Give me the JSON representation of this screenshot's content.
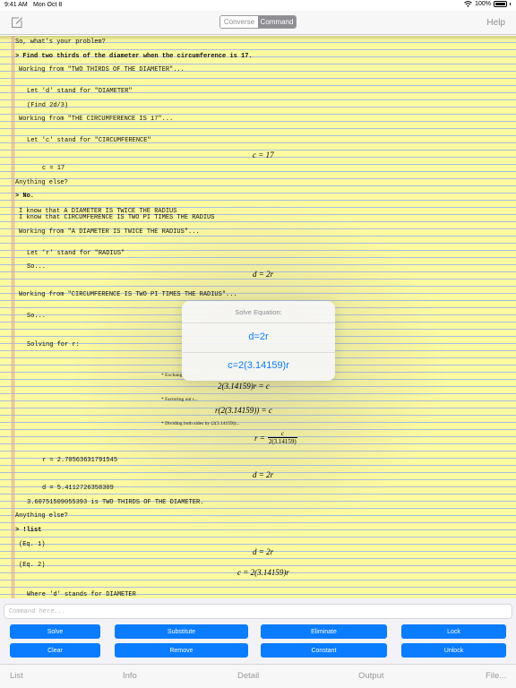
{
  "status_bar": {
    "time": "9:41 AM",
    "date": "Mon Oct 8",
    "battery": "100%"
  },
  "nav": {
    "segments": [
      "Converse",
      "Command"
    ],
    "active_segment": "Command",
    "help_label": "Help",
    "compose_icon": "compose-icon"
  },
  "transcript": {
    "lines": [
      "So, what's your problem?",
      "> Find two thirds of the diameter when the circumference is 17.",
      "Working from \"TWO THIRDS OF THE DIAMETER\"...",
      "Let 'd' stand for \"DIAMETER\"",
      "(Find 2d/3)",
      "Working from \"THE CIRCUMFERENCE IS 17\"...",
      "Let 'c' stand for \"CIRCUMFERENCE\"",
      "c = 17",
      "Anything else?",
      "> No.",
      "I know that A DIAMETER IS TWICE THE RADIUS",
      "I know that CIRCUMFERENCE IS TWO PI TIMES THE RADIUS",
      "Working from \"A DIAMETER IS TWICE THE RADIUS\"...",
      "Let 'r' stand for \"RADIUS\"",
      "So...",
      "Working from \"CIRCUMFERENCE IS TWO PI TIMES THE RADIUS\"...",
      "So...",
      "Solving for r:",
      "r = 2.70563631791545",
      "d = 5.4112726358309",
      "3.60751509055393 is TWO THIRDS OF THE DIAMETER.",
      "Anything else?",
      "> !list",
      "(Eq. 1)",
      "(Eq. 2)",
      "Where 'd' stands for DIAMETER"
    ],
    "math": {
      "c_eq": "c = 17",
      "d_eq": "d = 2r",
      "exchange": "2(3.14159)r = c",
      "factor": "r(2(3.14159)) = c",
      "divide_lhs": "r = ",
      "divide_num": "c",
      "divide_den": "2(3.14159)",
      "d_eq2": "d = 2r",
      "eq1": "d = 2r",
      "eq2": "c = 2(3.14159)r"
    },
    "notes": {
      "exchange": "* Exchanging sides...",
      "factor": "* Factoring out r...",
      "divide": "* Dividing both sides by (2(3.14159))..."
    }
  },
  "popover": {
    "title": "Solve Equation:",
    "options": [
      "d=2r",
      "c=2(3.14159)r"
    ]
  },
  "command": {
    "placeholder": "Command here..."
  },
  "buttons": {
    "row1": [
      "Solve",
      "Substitute",
      "Eliminate",
      "Lock"
    ],
    "row2": [
      "Clear",
      "Remove",
      "Constant",
      "Unlock"
    ]
  },
  "tabs": [
    "List",
    "Info",
    "Detail",
    "Output",
    "File..."
  ],
  "colors": {
    "accent": "#0a7cff",
    "pad": "#fdfaa0",
    "rule": "#a9bde0"
  }
}
